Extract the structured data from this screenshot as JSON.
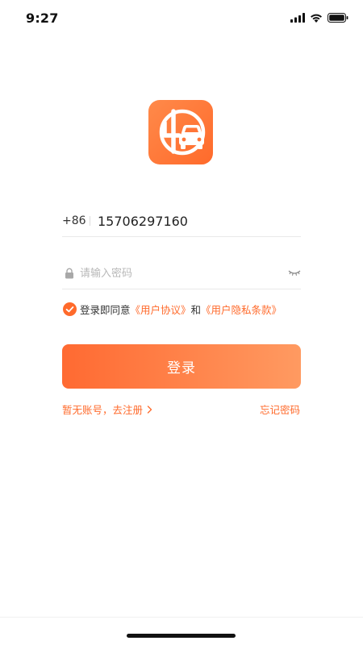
{
  "status_bar": {
    "time": "9:27",
    "icons": [
      "cellular-signal-icon",
      "wifi-icon",
      "battery-icon"
    ]
  },
  "logo": {
    "icon": "app-logo-4-car-icon",
    "colors": {
      "start": "#ff8a4a",
      "end": "#ff6a2b"
    }
  },
  "phone_field": {
    "country_code": "+86",
    "value": "15706297160"
  },
  "password_field": {
    "placeholder": "请输入密码",
    "lock_icon": "lock-icon",
    "toggle_icon": "eye-closed-icon"
  },
  "agreement": {
    "checked": true,
    "prefix": "登录即同意",
    "user_agreement": "《用户协议》",
    "conjunction": "和",
    "privacy_policy": "《用户隐私条款》"
  },
  "login_button": {
    "label": "登录"
  },
  "links": {
    "register": "暂无账号，去注册",
    "forgot_password": "忘记密码"
  },
  "colors": {
    "accent": "#ff6a2b",
    "button_gradient_start": "#ff6a32",
    "button_gradient_end": "#ff9a61"
  }
}
